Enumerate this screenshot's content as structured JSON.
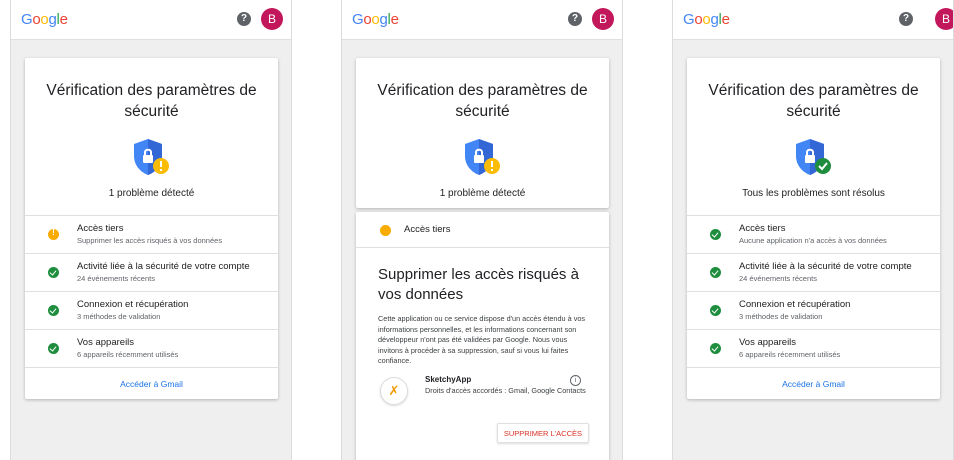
{
  "colors": {
    "brand_blue": "#4285f4",
    "brand_red": "#ea4335",
    "brand_yellow": "#fbbc05",
    "brand_green": "#34a853",
    "warning": "#f9ab00",
    "success": "#1e8e3e",
    "link": "#1a73e8",
    "danger": "#d93025",
    "avatar": "#c2185b"
  },
  "logo": {
    "text": "Google"
  },
  "avatar": {
    "initial": "B"
  },
  "help_icon": {
    "glyph": "?"
  },
  "screens": [
    {
      "title": "Vérification des paramètres de sécurité",
      "status": "1 problème détecté",
      "shield_state": "warning",
      "rows": [
        {
          "main": "Accès tiers",
          "sub": "Supprimer les accès risqués à vos données",
          "state": "warning"
        },
        {
          "main": "Activité liée à la sécurité de votre compte",
          "sub": "24 événements récents",
          "state": "ok"
        },
        {
          "main": "Connexion et récupération",
          "sub": "3 méthodes de validation",
          "state": "ok"
        },
        {
          "main": "Vos appareils",
          "sub": "6 appareils récemment utilisés",
          "state": "ok"
        }
      ],
      "gmail_link": "Accéder à Gmail"
    },
    {
      "title": "Vérification des paramètres de sécurité",
      "status": "1 problème détecté",
      "shield_state": "warning",
      "detail": {
        "header": "Accès tiers",
        "heading": "Supprimer les accès risqués à vos données",
        "description": "Cette application ou ce service dispose d'un accès étendu à vos informations personnelles, et les informations concernant son développeur n'ont pas été validées par Google. Nous vous invitons à procéder à sa suppression, sauf si vous lui faites confiance.",
        "app_name": "SketchyApp",
        "app_permissions": "Droits d'accès accordés : Gmail, Google Contacts",
        "remove_button": "SUPPRIMER L'ACCÈS"
      }
    },
    {
      "title": "Vérification des paramètres de sécurité",
      "status": "Tous les problèmes sont résolus",
      "shield_state": "ok",
      "rows": [
        {
          "main": "Accès tiers",
          "sub": "Aucune application n'a accès à vos données",
          "state": "ok"
        },
        {
          "main": "Activité liée à la sécurité de votre compte",
          "sub": "24 événements récents",
          "state": "ok"
        },
        {
          "main": "Connexion et récupération",
          "sub": "3 méthodes de validation",
          "state": "ok"
        },
        {
          "main": "Vos appareils",
          "sub": "6 appareils récemment utilisés",
          "state": "ok"
        }
      ],
      "gmail_link": "Accéder à Gmail"
    }
  ]
}
